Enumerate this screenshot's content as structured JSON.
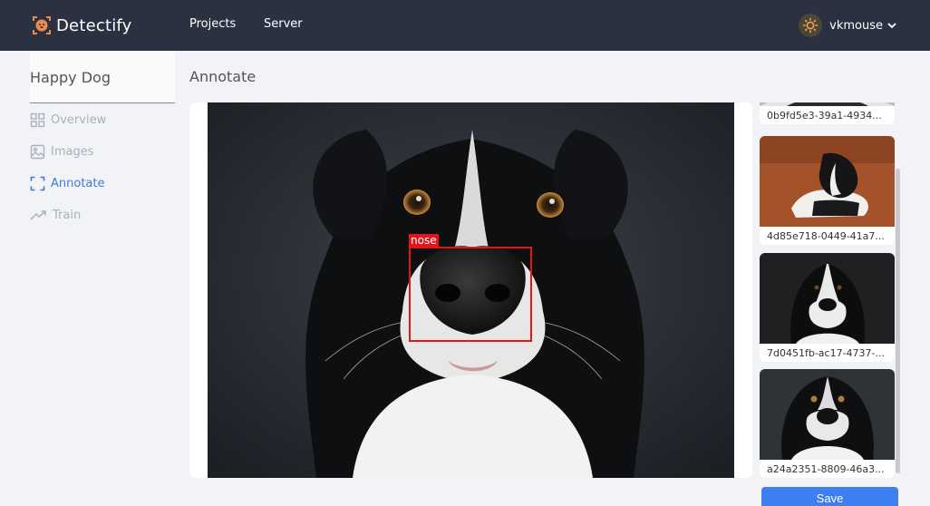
{
  "app": {
    "name": "Detectify"
  },
  "nav": {
    "projects": "Projects",
    "server": "Server"
  },
  "user": {
    "name": "vkmouse"
  },
  "sidebar": {
    "project_name": "Happy Dog",
    "items": [
      {
        "label": "Overview",
        "icon": "grid-icon",
        "active": false
      },
      {
        "label": "Images",
        "icon": "image-icon",
        "active": false
      },
      {
        "label": "Annotate",
        "icon": "focus-frame-icon",
        "active": true
      },
      {
        "label": "Train",
        "icon": "trending-up-icon",
        "active": false
      }
    ]
  },
  "main": {
    "title": "Annotate",
    "annotation": {
      "label": "nose"
    }
  },
  "thumbnails": [
    {
      "caption": "0b9fd5e3-39a1-4934..."
    },
    {
      "caption": "4d85e718-0449-41a7..."
    },
    {
      "caption": "7d0451fb-ac17-4737-..."
    },
    {
      "caption": "a24a2351-8809-46a3..."
    }
  ],
  "actions": {
    "save": "Save"
  },
  "colors": {
    "nav_bg": "#2b3140",
    "accent": "#3d7ad6",
    "bbox": "#e0161b",
    "save_button": "#3d7ef0"
  }
}
